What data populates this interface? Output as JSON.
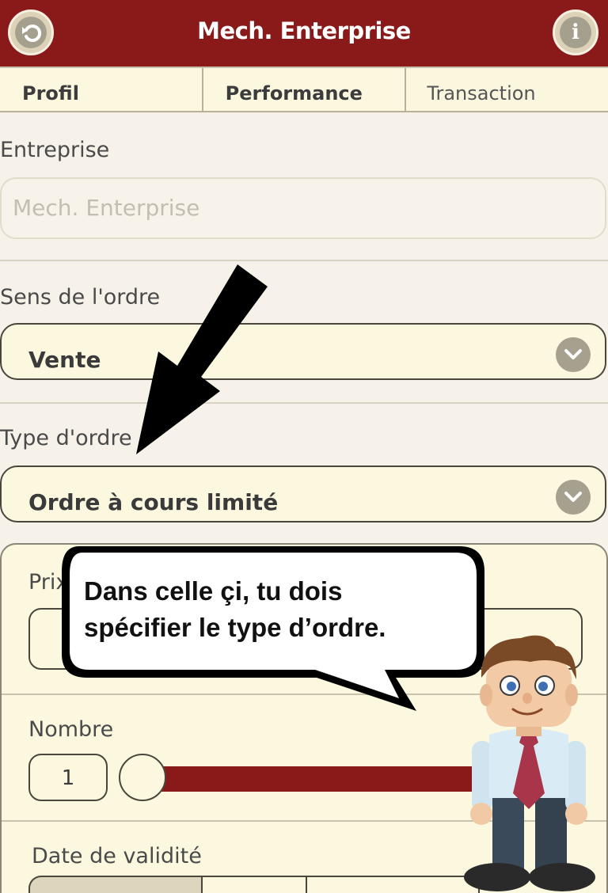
{
  "header": {
    "title": "Mech. Enterprise",
    "back_icon": "back-arrow-icon",
    "info_icon": "info-icon"
  },
  "tabs": [
    {
      "label": "Profil"
    },
    {
      "label": "Performance"
    },
    {
      "label": "Transaction"
    }
  ],
  "form": {
    "company": {
      "label": "Entreprise",
      "placeholder": "Mech. Enterprise"
    },
    "direction": {
      "label": "Sens de l'ordre",
      "value": "Vente"
    },
    "order_type": {
      "label": "Type d'ordre",
      "value": "Ordre à cours limité"
    },
    "price": {
      "label": "Prix"
    },
    "quantity": {
      "label": "Nombre",
      "value": "1"
    },
    "validity": {
      "label": "Date de validité"
    }
  },
  "tutorial": {
    "bubble_text": "Dans celle çi, tu dois spécifier le type d’ordre."
  },
  "colors": {
    "brand": "#8a1a1a",
    "panel": "#fcf8e0",
    "background": "#f6f2ea"
  }
}
